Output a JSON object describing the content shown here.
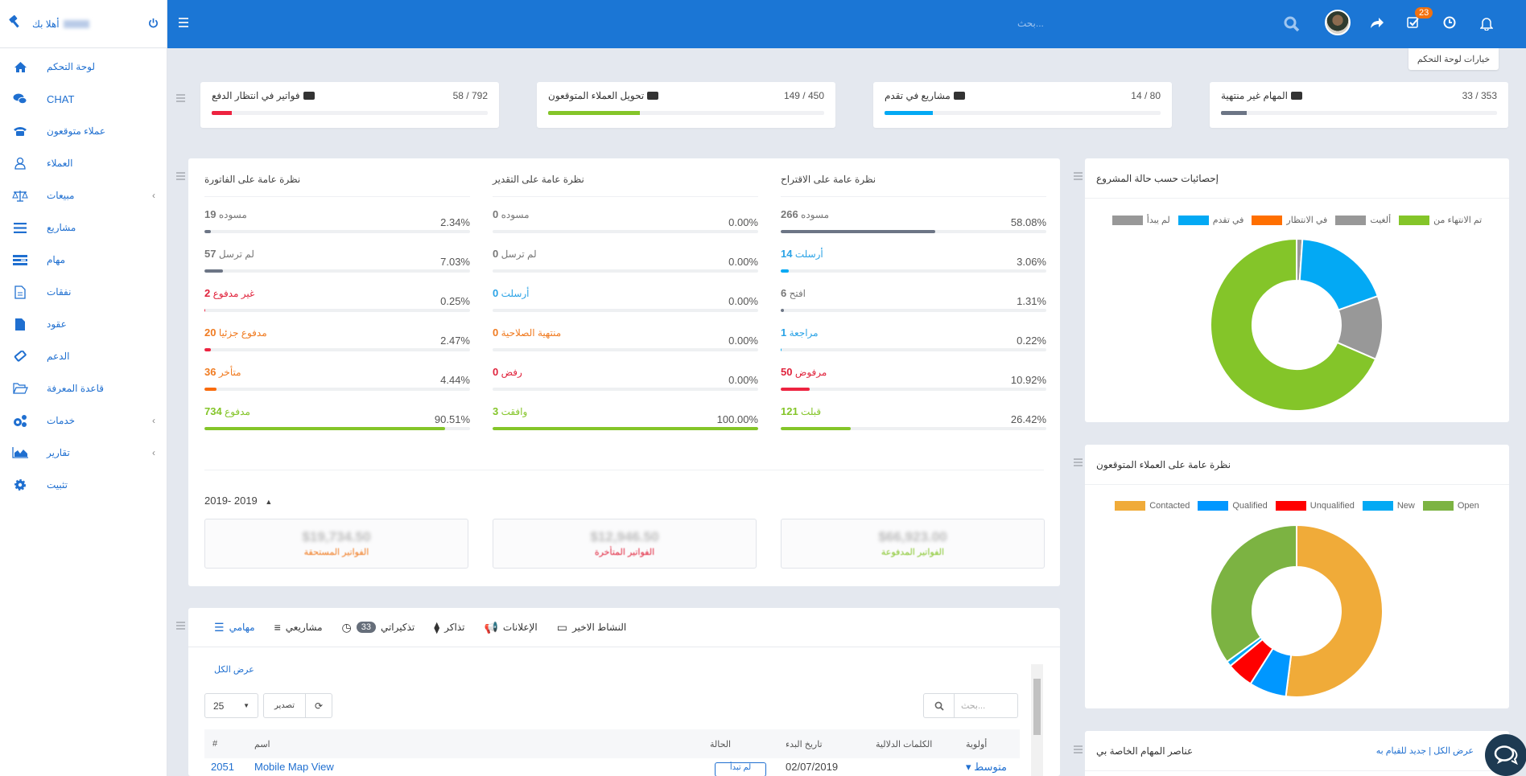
{
  "sidebar": {
    "welcome": "أهلا بك",
    "items": [
      {
        "label": "لوحة التحكم",
        "icon": "home-icon"
      },
      {
        "label": "CHAT",
        "icon": "chat-icon"
      },
      {
        "label": "عملاء متوقعون",
        "icon": "phone-icon"
      },
      {
        "label": "العملاء",
        "icon": "user-icon"
      },
      {
        "label": "مبيعات",
        "icon": "scale-icon",
        "has_submenu": true
      },
      {
        "label": "مشاريع",
        "icon": "bars-icon"
      },
      {
        "label": "مهام",
        "icon": "tasks-icon"
      },
      {
        "label": "نفقات",
        "icon": "file-text-icon"
      },
      {
        "label": "عقود",
        "icon": "file-icon"
      },
      {
        "label": "الدعم",
        "icon": "ticket-icon"
      },
      {
        "label": "قاعدة المعرفة",
        "icon": "folder-open-icon"
      },
      {
        "label": "خدمات",
        "icon": "cogs-icon",
        "has_submenu": true
      },
      {
        "label": "تقارير",
        "icon": "area-chart-icon",
        "has_submenu": true
      },
      {
        "label": "تثبيت",
        "icon": "cog-icon"
      }
    ]
  },
  "topbar": {
    "search_placeholder": "بحث...",
    "notifications_badge": "23"
  },
  "dashboard_options": "خيارات لوحة التحكم",
  "stats": [
    {
      "title": "فواتير في انتظار الدفع",
      "value": "58 / 792",
      "progress": 7.3,
      "color": "#ed2340"
    },
    {
      "title": "تحويل العملاء المتوقعون",
      "value": "149 / 450",
      "progress": 33.1,
      "color": "#84c529"
    },
    {
      "title": "مشاريع في تقدم",
      "value": "14 / 80",
      "progress": 17.5,
      "color": "#03a9f4"
    },
    {
      "title": "المهام غير منتهية",
      "value": "33 / 353",
      "progress": 9.3,
      "color": "#6c7585"
    }
  ],
  "overview": {
    "columns": [
      {
        "title": "نظرة عامة على الفاتورة",
        "items": [
          {
            "label": "مسوده",
            "count": "19",
            "pct": "2.34%",
            "value": 2.34,
            "color": "#6c7585",
            "textcolor": "#777"
          },
          {
            "label": "لم ترسل",
            "count": "57",
            "pct": "7.03%",
            "value": 7.03,
            "color": "#6c7585",
            "textcolor": "#777"
          },
          {
            "label": "غير مدفوع",
            "count": "2",
            "pct": "0.25%",
            "value": 0.25,
            "color": "#ed2340",
            "textcolor": "#e0233c"
          },
          {
            "label": "مدفوع جزئيا",
            "count": "20",
            "pct": "2.47%",
            "value": 2.47,
            "color": "#ed2340",
            "textcolor": "#f07b21"
          },
          {
            "label": "متأخر",
            "count": "36",
            "pct": "4.44%",
            "value": 4.44,
            "color": "#f96b0c",
            "textcolor": "#f07b21"
          },
          {
            "label": "مدفوع",
            "count": "734",
            "pct": "90.51%",
            "value": 90.51,
            "color": "#84c529",
            "textcolor": "#84c529"
          }
        ]
      },
      {
        "title": "نظرة عامة على التقدير",
        "items": [
          {
            "label": "مسوده",
            "count": "0",
            "pct": "0.00%",
            "value": 0,
            "color": "#6c7585",
            "textcolor": "#777"
          },
          {
            "label": "لم ترسل",
            "count": "0",
            "pct": "0.00%",
            "value": 0,
            "color": "#6c7585",
            "textcolor": "#777"
          },
          {
            "label": "أرسلت",
            "count": "0",
            "pct": "0.00%",
            "value": 0,
            "color": "#03a9f4",
            "textcolor": "#2ba3e6"
          },
          {
            "label": "منتهية الصلاحية",
            "count": "0",
            "pct": "0.00%",
            "value": 0,
            "color": "#f07b21",
            "textcolor": "#f07b21"
          },
          {
            "label": "رفض",
            "count": "0",
            "pct": "0.00%",
            "value": 0,
            "color": "#ed2340",
            "textcolor": "#e0233c"
          },
          {
            "label": "وافقت",
            "count": "3",
            "pct": "100.00%",
            "value": 100,
            "color": "#84c529",
            "textcolor": "#84c529"
          }
        ]
      },
      {
        "title": "نظرة عامة على الاقتراح",
        "items": [
          {
            "label": "مسوده",
            "count": "266",
            "pct": "58.08%",
            "value": 58.08,
            "color": "#6c7585",
            "textcolor": "#777"
          },
          {
            "label": "أرسلت",
            "count": "14",
            "pct": "3.06%",
            "value": 3.06,
            "color": "#03a9f4",
            "textcolor": "#2ba3e6"
          },
          {
            "label": "افتح",
            "count": "6",
            "pct": "1.31%",
            "value": 1.31,
            "color": "#6c7585",
            "textcolor": "#777"
          },
          {
            "label": "مراجعة",
            "count": "1",
            "pct": "0.22%",
            "value": 0.22,
            "color": "#03a9f4",
            "textcolor": "#2ba3e6"
          },
          {
            "label": "مرفوض",
            "count": "50",
            "pct": "10.92%",
            "value": 10.92,
            "color": "#ed2340",
            "textcolor": "#e0233c"
          },
          {
            "label": "قبلت",
            "count": "121",
            "pct": "26.42%",
            "value": 26.42,
            "color": "#84c529",
            "textcolor": "#84c529"
          }
        ]
      }
    ],
    "year_range": "2019- 2019",
    "totals": [
      {
        "amount": "$19,734.50",
        "caption": "الفواتير المستحقة",
        "color": "#f07b21"
      },
      {
        "amount": "$12,946.50",
        "caption": "الفواتير المتأخرة",
        "color": "#e0233c"
      },
      {
        "amount": "$66,923.00",
        "caption": "الفواتير المدفوعة",
        "color": "#84c529"
      }
    ]
  },
  "tasks_widget": {
    "tabs": [
      {
        "label": "مهامي",
        "icon": "tasks-icon",
        "active": true
      },
      {
        "label": "مشاريعي",
        "icon": "bars-icon"
      },
      {
        "label": "تذكيراتي",
        "icon": "clock-icon",
        "count": "33"
      },
      {
        "label": "تذاكر",
        "icon": "ticket-icon"
      },
      {
        "label": "الإعلانات",
        "icon": "bullhorn-icon"
      },
      {
        "label": "النشاط الاخير",
        "icon": "window-icon"
      }
    ],
    "view_all": "عرض الكل",
    "page_length": "25",
    "export_label": "تصدير",
    "search_placeholder": "بحث...",
    "columns": [
      "#",
      "اسم",
      "الحالة",
      "تاريخ البدء",
      "الكلمات الدلالية",
      "أولوية"
    ],
    "rows": [
      {
        "id": "2051",
        "name": "Mobile Map View",
        "status": "لم تبدأ",
        "start_date": "02/07/2019",
        "tags": "",
        "priority": "متوسط"
      }
    ]
  },
  "project_status_chart": {
    "title": "إحصائيات حسب حالة المشروع",
    "chart_data": {
      "type": "pie",
      "title": "إحصائيات حسب حالة المشروع",
      "legend_position": "top",
      "series": [
        {
          "name": "تم الانتهاء من",
          "value": 63,
          "color": "#84c529"
        },
        {
          "name": "ألغيت",
          "value": 11,
          "color": "#989898"
        },
        {
          "name": "في الانتظار",
          "value": 0,
          "color": "#ff6f00"
        },
        {
          "name": "في تقدم",
          "value": 17,
          "color": "#03a9f4"
        },
        {
          "name": "لم يبدأ",
          "value": 1,
          "color": "#989898"
        }
      ]
    }
  },
  "leads_chart": {
    "title": "نظرة عامة على العملاء المتوقعون",
    "chart_data": {
      "type": "pie",
      "title": "نظرة عامة على العملاء المتوقعون",
      "legend_position": "top",
      "series": [
        {
          "name": "Contacted",
          "value": 52,
          "color": "#f0ab39"
        },
        {
          "name": "Qualified",
          "value": 7,
          "color": "#0097ff"
        },
        {
          "name": "Unqualified",
          "value": 5,
          "color": "#ff0000"
        },
        {
          "name": "New",
          "value": 1,
          "color": "#03a9f4"
        },
        {
          "name": "Open",
          "value": 35,
          "color": "#7cb342"
        }
      ]
    }
  },
  "my_todo": {
    "title": "عناصر المهام الخاصة بي",
    "links": "عرض الكل | جديد للقيام به"
  }
}
